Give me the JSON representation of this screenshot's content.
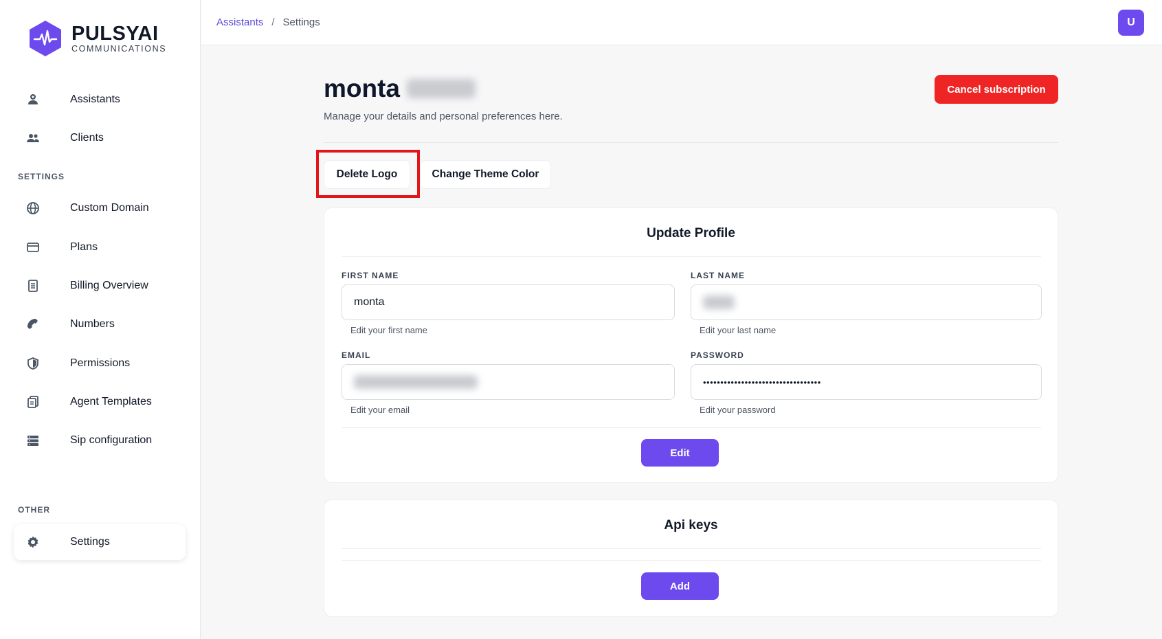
{
  "brand": {
    "name": "PULSYAI",
    "sub": "COMMUNICATIONS",
    "accent": "#6d4aee"
  },
  "sidebar": {
    "items": [
      {
        "label": "Assistants",
        "icon": "assistant-icon"
      },
      {
        "label": "Clients",
        "icon": "users-icon"
      }
    ],
    "settings_label": "SETTINGS",
    "settings_items": [
      {
        "label": "Custom Domain",
        "icon": "globe-icon"
      },
      {
        "label": "Plans",
        "icon": "credit-card-icon"
      },
      {
        "label": "Billing Overview",
        "icon": "document-icon"
      },
      {
        "label": "Numbers",
        "icon": "phone-icon"
      },
      {
        "label": "Permissions",
        "icon": "shield-icon"
      },
      {
        "label": "Agent Templates",
        "icon": "templates-icon"
      },
      {
        "label": "Sip configuration",
        "icon": "server-icon"
      }
    ],
    "other_label": "OTHER",
    "other_items": [
      {
        "label": "Settings",
        "icon": "gear-icon",
        "active": true
      }
    ]
  },
  "topbar": {
    "breadcrumb": {
      "link": "Assistants",
      "separator": "/",
      "current": "Settings"
    },
    "avatar_initial": "U"
  },
  "header": {
    "title": "monta",
    "subtitle": "Manage your details and personal preferences here.",
    "cancel_label": "Cancel subscription"
  },
  "actions": {
    "delete_logo": "Delete Logo",
    "change_theme": "Change Theme Color"
  },
  "profile": {
    "title": "Update Profile",
    "first_name": {
      "label": "FIRST NAME",
      "value": "monta",
      "hint": "Edit your first name"
    },
    "last_name": {
      "label": "LAST NAME",
      "value": "",
      "hint": "Edit your last name"
    },
    "email": {
      "label": "EMAIL",
      "value": "",
      "hint": "Edit your email"
    },
    "password": {
      "label": "PASSWORD",
      "value": "••••••••••••••••••••••••••••••••••",
      "hint": "Edit your password"
    },
    "edit_label": "Edit"
  },
  "api_keys": {
    "title": "Api keys",
    "add_label": "Add"
  }
}
